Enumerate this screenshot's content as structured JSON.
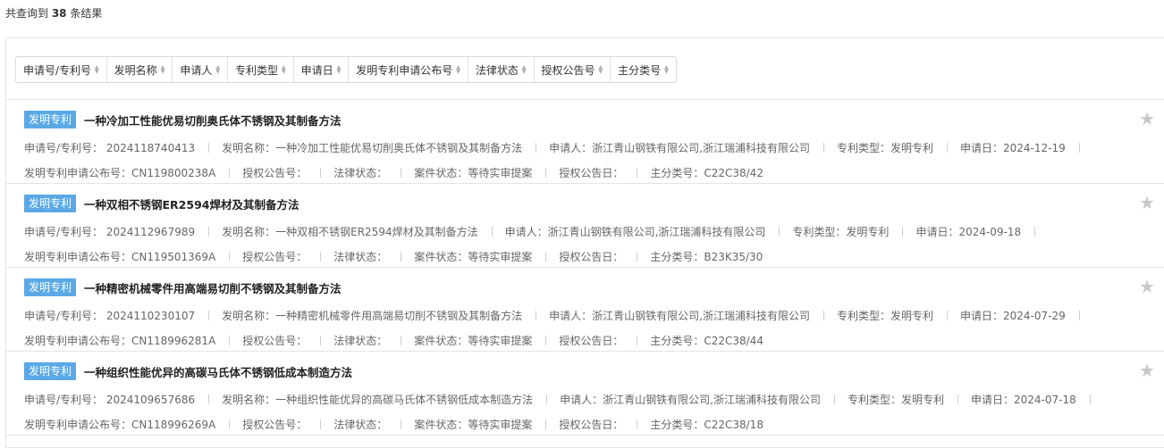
{
  "summary": {
    "prefix": "共查询到 ",
    "count": "38",
    "suffix": " 条结果"
  },
  "sort_bar": [
    "申请号/专利号",
    "发明名称",
    "申请人",
    "专利类型",
    "申请日",
    "发明专利申请公布号",
    "法律状态",
    "授权公告号",
    "主分类号"
  ],
  "patents": [
    {
      "tag": "发明专利",
      "title": "一种冷加工性能优易切削奥氏体不锈钢及其制备方法",
      "fields": [
        "申请号/专利号：  2024118740413",
        "发明名称：一种冷加工性能优易切削奥氏体不锈钢及其制备方法",
        "申请人：浙江青山钢铁有限公司,浙江瑞浦科技有限公司",
        "专利类型：发明专利",
        "申请日：2024-12-19",
        "发明专利申请公布号：CN119800238A",
        "授权公告号：",
        "法律状态：",
        "案件状态：等待实审提案",
        "授权公告日：",
        "主分类号：C22C38/42"
      ]
    },
    {
      "tag": "发明专利",
      "title": "一种双相不锈钢ER2594焊材及其制备方法",
      "fields": [
        "申请号/专利号：  2024112967989",
        "发明名称：一种双相不锈钢ER2594焊材及其制备方法",
        "申请人：浙江青山钢铁有限公司,浙江瑞浦科技有限公司",
        "专利类型：发明专利",
        "申请日：2024-09-18",
        "发明专利申请公布号：CN119501369A",
        "授权公告号：",
        "法律状态：",
        "案件状态：等待实审提案",
        "授权公告日：",
        "主分类号：B23K35/30"
      ]
    },
    {
      "tag": "发明专利",
      "title": "一种精密机械零件用高端易切削不锈钢及其制备方法",
      "fields": [
        "申请号/专利号：  2024110230107",
        "发明名称：一种精密机械零件用高端易切削不锈钢及其制备方法",
        "申请人：浙江青山钢铁有限公司,浙江瑞浦科技有限公司",
        "专利类型：发明专利",
        "申请日：2024-07-29",
        "发明专利申请公布号：CN118996281A",
        "授权公告号：",
        "法律状态：",
        "案件状态：等待实审提案",
        "授权公告日：",
        "主分类号：C22C38/44"
      ]
    },
    {
      "tag": "发明专利",
      "title": "一种组织性能优异的高碳马氏体不锈钢低成本制造方法",
      "fields": [
        "申请号/专利号：  2024109657686",
        "发明名称：一种组织性能优异的高碳马氏体不锈钢低成本制造方法",
        "申请人：浙江青山钢铁有限公司,浙江瑞浦科技有限公司",
        "专利类型：发明专利",
        "申请日：2024-07-18",
        "发明专利申请公布号：CN118996269A",
        "授权公告号：",
        "法律状态：",
        "案件状态：等待实审提案",
        "授权公告日：",
        "主分类号：C22C38/18"
      ]
    }
  ],
  "icons": {
    "star": "star-icon",
    "sort": "sort-arrows-icon"
  },
  "colors": {
    "tag_bg": "#5aa9e6",
    "star": "#c8c8c8"
  }
}
